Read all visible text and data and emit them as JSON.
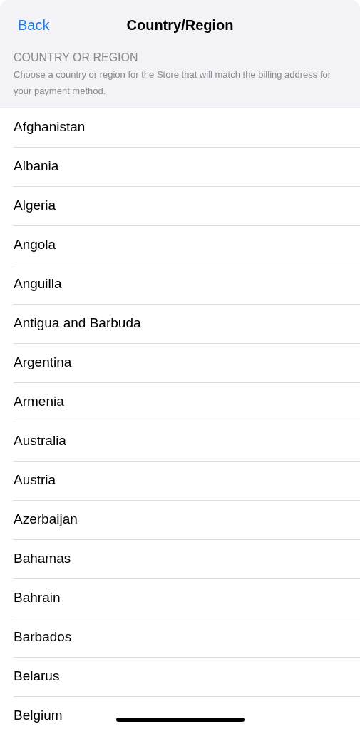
{
  "nav_bar": {
    "back": "Back",
    "title": "Country/Region"
  },
  "section": {
    "header": "COUNTRY OR REGION",
    "description": "Choose a country or region for the Store that will match the billing address for your payment method."
  },
  "countries": [
    {
      "label": "Afghanistan"
    },
    {
      "label": "Albania"
    },
    {
      "label": "Algeria"
    },
    {
      "label": "Angola"
    },
    {
      "label": "Anguilla"
    },
    {
      "label": "Antigua and Barbuda"
    },
    {
      "label": "Argentina"
    },
    {
      "label": "Armenia"
    },
    {
      "label": "Australia"
    },
    {
      "label": "Austria"
    },
    {
      "label": "Azerbaijan"
    },
    {
      "label": "Bahamas"
    },
    {
      "label": "Bahrain"
    },
    {
      "label": "Barbados"
    },
    {
      "label": "Belarus"
    },
    {
      "label": "Belgium"
    }
  ]
}
